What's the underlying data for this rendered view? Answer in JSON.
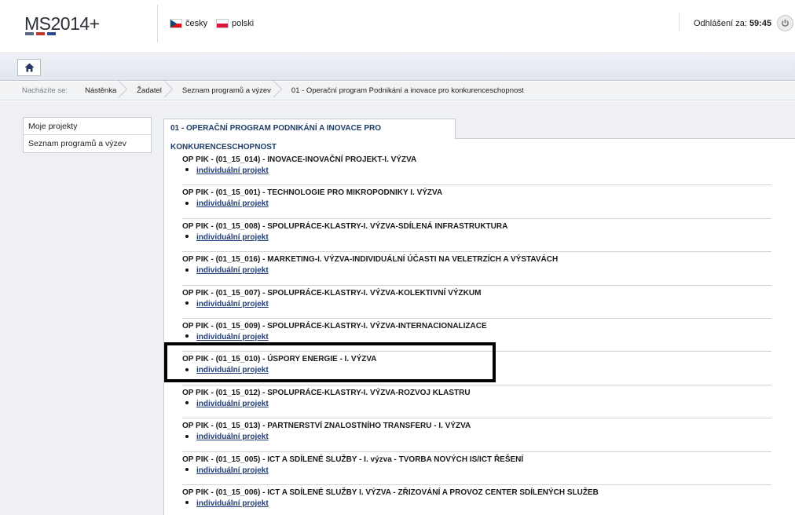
{
  "header": {
    "logo_text": "MS2014+",
    "languages": [
      {
        "label": "česky"
      },
      {
        "label": "polski"
      }
    ],
    "logout_label": "Odhlášení za:",
    "logout_time": "59:45"
  },
  "breadcrumb": {
    "label": "Nacházíte se:",
    "items": [
      "Nástěnka",
      "Žadatel",
      "Seznam programů a výzev",
      "01 - Operační program Podnikání a inovace pro konkurenceschopnost"
    ]
  },
  "sidebar": {
    "items": [
      "Moje projekty",
      "Seznam programů a výzev"
    ]
  },
  "main": {
    "tab_title": "01 - OPERAČNÍ PROGRAM PODNIKÁNÍ A INOVACE PRO KONKURENCESCHOPNOST",
    "calls": [
      {
        "title": "OP PIK - (01_15_014) - INOVACE-INOVAČNÍ PROJEKT-I. VÝZVA",
        "link": "individuální projekt"
      },
      {
        "title": "OP PIK - (01_15_001) - TECHNOLOGIE PRO MIKROPODNIKY I. VÝZVA",
        "link": "individuální projekt"
      },
      {
        "title": "OP PIK - (01_15_008) - SPOLUPRÁCE-KLASTRY-I. VÝZVA-SDÍLENÁ INFRASTRUKTURA",
        "link": "individuální projekt"
      },
      {
        "title": "OP PIK - (01_15_016) - MARKETING-I. VÝZVA-INDIVIDUÁLNÍ ÚČASTI NA VELETRZÍCH A VÝSTAVÁCH",
        "link": "individuální projekt"
      },
      {
        "title": "OP PIK - (01_15_007) - SPOLUPRÁCE-KLASTRY-I. VÝZVA-KOLEKTIVNÍ VÝZKUM",
        "link": "individuální projekt"
      },
      {
        "title": "OP PIK - (01_15_009) - SPOLUPRÁCE-KLASTRY-I. VÝZVA-INTERNACIONALIZACE",
        "link": "individuální projekt"
      },
      {
        "title": "OP PIK - (01_15_010) - ÚSPORY ENERGIE - I. VÝZVA",
        "link": "individuální projekt"
      },
      {
        "title": "OP PIK - (01_15_012) - SPOLUPRÁCE-KLASTRY-I. VÝZVA-ROZVOJ KLASTRU",
        "link": "individuální projekt"
      },
      {
        "title": "OP PIK - (01_15_013) - PARTNERSTVÍ ZNALOSTNÍHO TRANSFERU - I. VÝZVA",
        "link": "individuální projekt"
      },
      {
        "title": "OP PIK - (01_15_005) - ICT A SDÍLENÉ SLUŽBY - I. výzva - TVORBA NOVÝCH IS/ICT ŘEŠENÍ",
        "link": "individuální projekt"
      },
      {
        "title": "OP PIK - (01_15_006) - ICT A SDÍLENÉ SLUŽBY I. VÝZVA - ZŘIZOVÁNÍ A PROVOZ CENTER SDÍLENÝCH SLUŽEB",
        "link": "individuální projekt"
      }
    ]
  },
  "colors": {
    "accent": "#1f3d66",
    "link": "#1f3d7a",
    "logo_red": "#c0392b"
  }
}
